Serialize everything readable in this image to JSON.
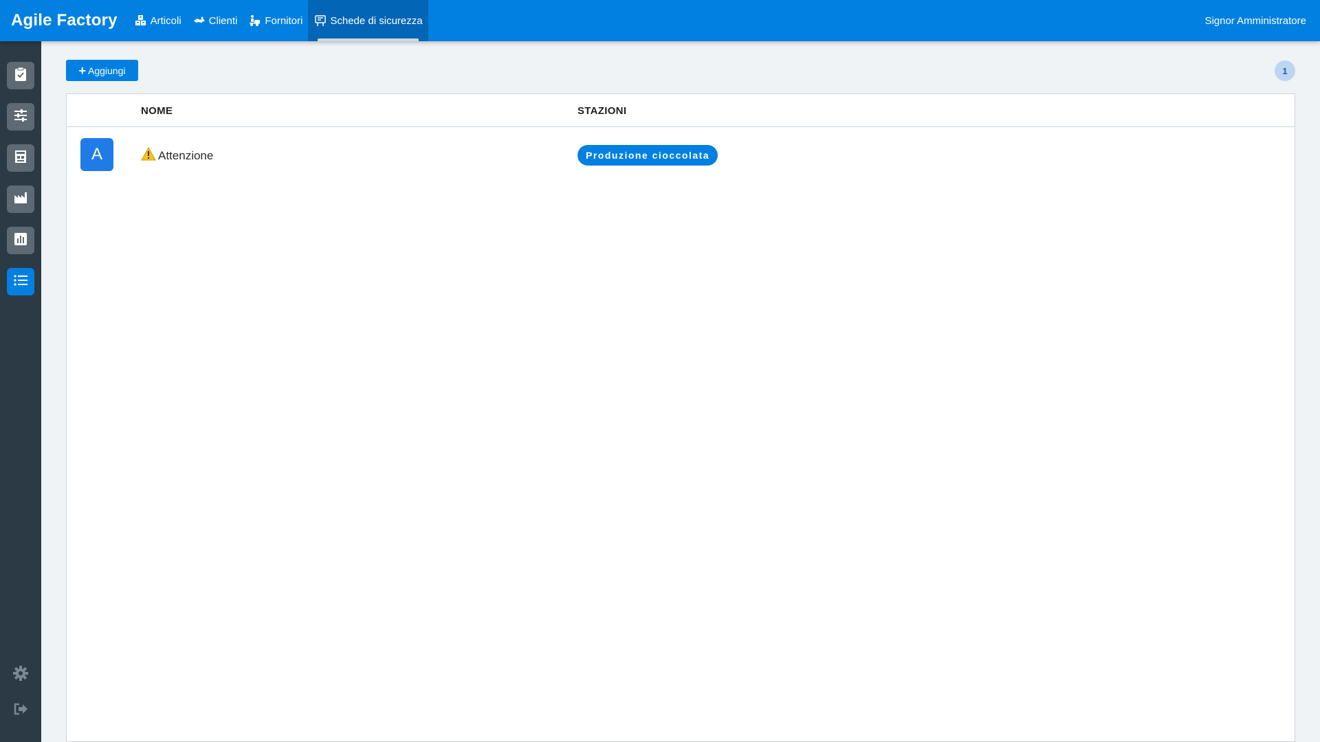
{
  "app": {
    "title": "Agile Factory"
  },
  "nav": {
    "items": [
      {
        "label": "Articoli",
        "icon": "boxes-icon"
      },
      {
        "label": "Clienti",
        "icon": "handshake-icon"
      },
      {
        "label": "Fornitori",
        "icon": "forklift-icon"
      },
      {
        "label": "Schede di sicurezza",
        "icon": "safety-sheet-icon",
        "active": true
      }
    ]
  },
  "user": {
    "name": "Signor Amministratore"
  },
  "sidebar": {
    "items": [
      {
        "icon": "clipboard-check-icon"
      },
      {
        "icon": "sliders-icon"
      },
      {
        "icon": "warehouse-icon"
      },
      {
        "icon": "factory-icon"
      },
      {
        "icon": "bar-chart-icon"
      },
      {
        "icon": "list-icon",
        "active": true
      }
    ],
    "bottom": [
      {
        "icon": "gear-icon"
      },
      {
        "icon": "logout-icon"
      }
    ]
  },
  "toolbar": {
    "add_label": "Aggiungi",
    "count": "1"
  },
  "table": {
    "columns": [
      "NOME",
      "STAZIONI"
    ],
    "rows": [
      {
        "initial": "A",
        "name": "Attenzione",
        "icon": "warning-icon",
        "stations": [
          "Produzione cioccolata"
        ]
      }
    ]
  },
  "colors": {
    "primary": "#0280e1",
    "sidebar": "#2c3a45",
    "background": "#eff3f6"
  }
}
